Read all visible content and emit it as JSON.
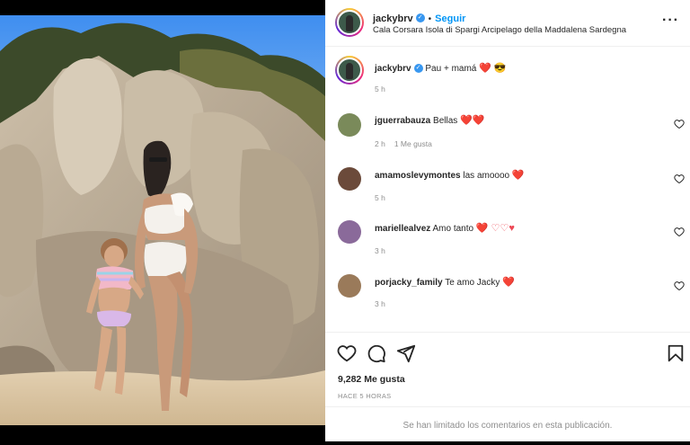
{
  "post": {
    "username": "jackybrv",
    "follow_label": "Seguir",
    "location": "Cala Corsara Isola di Spargi Arcipelago della Maddalena Sardegna",
    "more_icon": "more-horizontal-icon"
  },
  "caption": {
    "username": "jackybrv",
    "text": "Pau + mamá",
    "emojis": "❤️ 😎",
    "time": "5 h"
  },
  "comments": [
    {
      "username": "jguerrabauza",
      "text": "Bellas",
      "emojis": "❤️❤️",
      "time": "2 h",
      "likes": "1 Me gusta"
    },
    {
      "username": "amamoslevymontes",
      "text": "las amoooo",
      "emojis": "❤️",
      "time": "5 h",
      "likes": ""
    },
    {
      "username": "mariellealvez",
      "text": "Amo tanto",
      "emojis": "❤️ ♡♡♥",
      "time": "3 h",
      "likes": ""
    },
    {
      "username": "porjacky_family",
      "text": "Te amo Jacky",
      "emojis": "❤️",
      "time": "3 h",
      "likes": ""
    }
  ],
  "actions": {
    "like_icon": "heart-icon",
    "comment_icon": "comment-icon",
    "share_icon": "share-icon",
    "save_icon": "bookmark-icon"
  },
  "likes_text": "9,282 Me gusta",
  "posted_ago": "HACE 5 HORAS",
  "comments_limited": "Se han limitado los comentarios en esta publicación.",
  "colors": {
    "accent": "#0095f6",
    "heart": "#ed4956",
    "verified": "#3897f0",
    "muted": "#8e8e8e"
  }
}
